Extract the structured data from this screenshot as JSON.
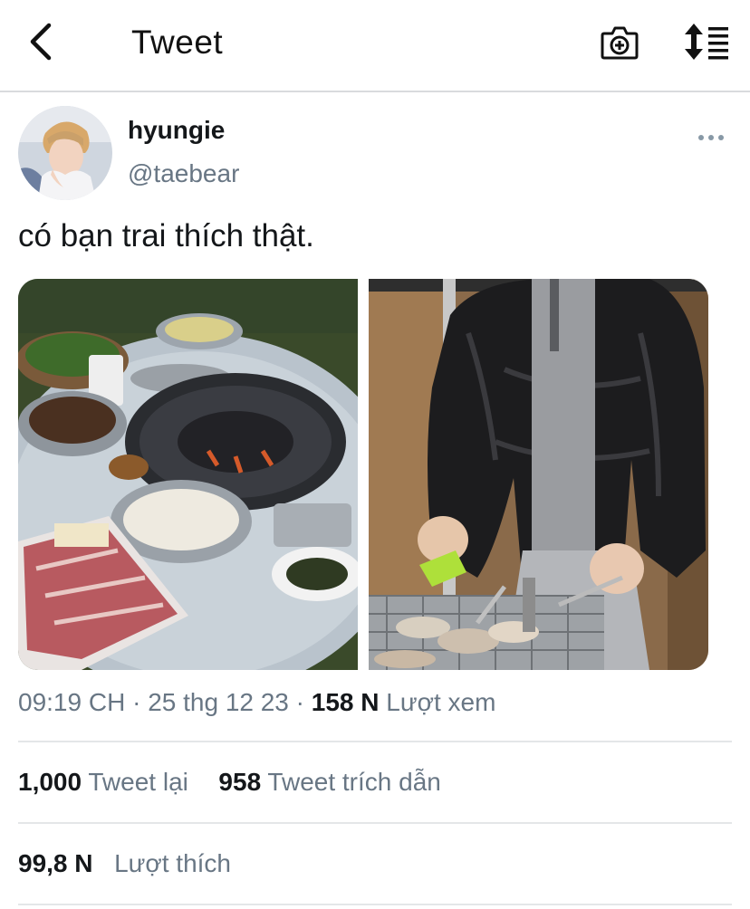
{
  "header": {
    "title": "Tweet",
    "icons": {
      "back": "chevron-left-icon",
      "camera": "camera-plus-icon",
      "sort": "sort-timeline-icon"
    }
  },
  "tweet": {
    "display_name": "hyungie",
    "handle": "@taebear",
    "text": "có bạn trai thích thật.",
    "time": "09:19 CH",
    "date": "25 thg 12 23",
    "views_count": "158 N",
    "views_label": "Lượt xem",
    "separator": "·"
  },
  "stats": {
    "retweets_count": "1,000",
    "retweets_label": "Tweet lại",
    "quotes_count": "958",
    "quotes_label": "Tweet trích dẫn",
    "likes_count": "99,8 N",
    "likes_label": "Lượt thích"
  },
  "colors": {
    "text": "#14171a",
    "secondary": "#687684",
    "divider": "#e4e6e8"
  }
}
